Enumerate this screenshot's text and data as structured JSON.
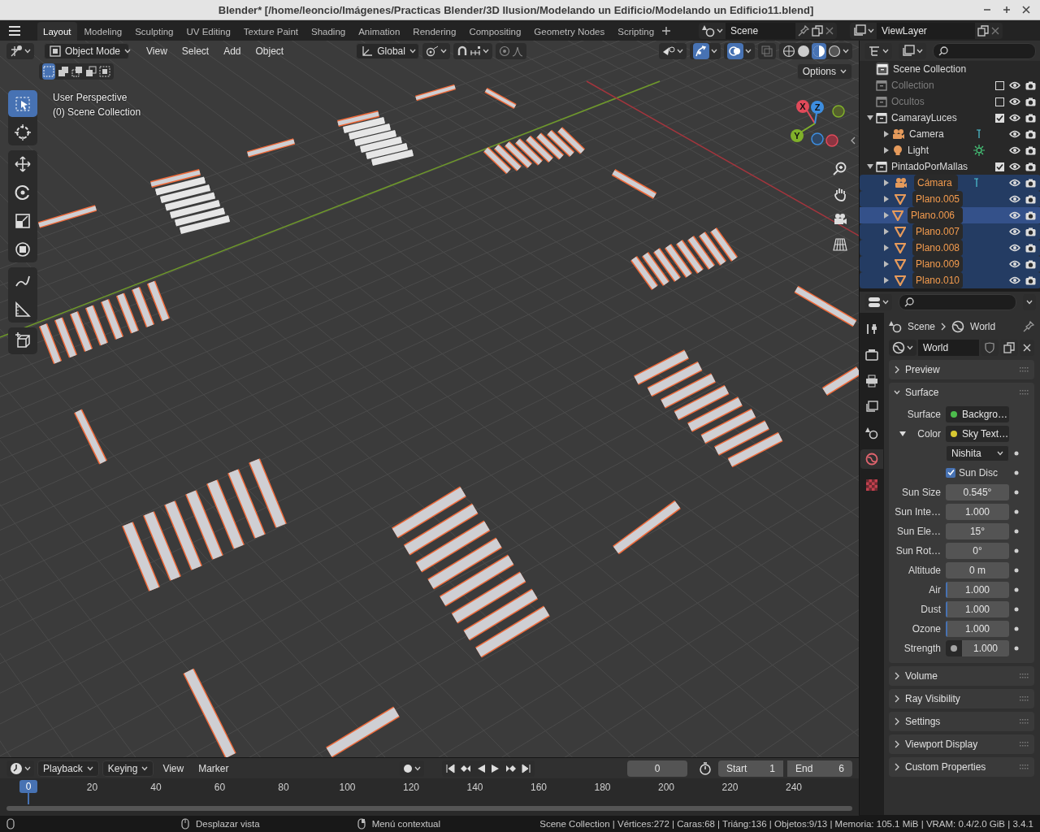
{
  "window": {
    "title": "Blender* [/home/leoncio/Imágenes/Practicas Blender/3D Ilusion/Modelando un Edificio/Modelando un Edificio11.blend]"
  },
  "workspace_tabs": [
    {
      "label": "Layout",
      "selected": true
    },
    {
      "label": "Modeling",
      "selected": false
    },
    {
      "label": "Sculpting",
      "selected": false
    },
    {
      "label": "UV Editing",
      "selected": false
    },
    {
      "label": "Texture Paint",
      "selected": false
    },
    {
      "label": "Shading",
      "selected": false
    },
    {
      "label": "Animation",
      "selected": false
    },
    {
      "label": "Rendering",
      "selected": false
    },
    {
      "label": "Compositing",
      "selected": false
    },
    {
      "label": "Geometry Nodes",
      "selected": false
    },
    {
      "label": "Scripting",
      "selected": false
    }
  ],
  "scene": {
    "name": "Scene"
  },
  "view_layer": {
    "name": "ViewLayer"
  },
  "viewport": {
    "mode": "Object Mode",
    "menus": [
      "View",
      "Select",
      "Add",
      "Object"
    ],
    "orientation": "Global",
    "options_label": "Options",
    "overlay_lines": [
      "User Perspective",
      "(0) Scene Collection"
    ],
    "axes": [
      "X",
      "Z",
      "Y"
    ]
  },
  "outliner": {
    "root": "Scene Collection",
    "items": [
      {
        "name": "Collection",
        "kind": "collection",
        "checked": false
      },
      {
        "name": "Ocultos",
        "kind": "collection",
        "checked": false
      },
      {
        "name": "CamarayLuces",
        "kind": "collection",
        "checked": true,
        "expanded": true,
        "children": [
          {
            "name": "Camera",
            "kind": "camera",
            "expanded": false,
            "selected": false,
            "active": false
          },
          {
            "name": "Light",
            "kind": "light",
            "expanded": false,
            "selected": false,
            "active": false
          }
        ]
      },
      {
        "name": "PintadoPorMallas",
        "kind": "collection",
        "checked": true,
        "expanded": true,
        "children": [
          {
            "name": "Cámara",
            "kind": "camera",
            "expanded": false,
            "selected": true,
            "active": false
          },
          {
            "name": "Plano.005",
            "kind": "mesh",
            "expanded": false,
            "selected": true,
            "active": false
          },
          {
            "name": "Plano.006",
            "kind": "mesh",
            "expanded": false,
            "selected": true,
            "active": true
          },
          {
            "name": "Plano.007",
            "kind": "mesh",
            "expanded": false,
            "selected": true,
            "active": false
          },
          {
            "name": "Plano.008",
            "kind": "mesh",
            "expanded": false,
            "selected": true,
            "active": false
          },
          {
            "name": "Plano.009",
            "kind": "mesh",
            "expanded": false,
            "selected": true,
            "active": false
          },
          {
            "name": "Plano.010",
            "kind": "mesh",
            "expanded": false,
            "selected": true,
            "active": false
          }
        ]
      }
    ]
  },
  "properties": {
    "tabs": [
      {
        "kind": "tool",
        "selected": false
      },
      {
        "kind": "render",
        "selected": false
      },
      {
        "kind": "output",
        "selected": false
      },
      {
        "kind": "view_layer",
        "selected": false
      },
      {
        "kind": "scene",
        "selected": false
      },
      {
        "kind": "world",
        "selected": true
      },
      {
        "kind": "texture",
        "selected": false
      }
    ],
    "breadcrumb": [
      "Scene",
      "World"
    ],
    "datablock": "World",
    "panels": [
      {
        "title": "Preview",
        "expanded": false
      },
      {
        "title": "Surface",
        "expanded": true,
        "rows": [
          {
            "kind": "socket",
            "label": "Surface",
            "value": "Backgro…",
            "color": "#4cbb4c"
          },
          {
            "kind": "socket",
            "label": "Color",
            "value": "Sky Text…",
            "color": "#d8c832",
            "expanded": true
          },
          {
            "kind": "dropdown",
            "value": "Nishita"
          },
          {
            "kind": "checkbox",
            "label": "Sun Disc",
            "checked": true
          },
          {
            "kind": "number",
            "label": "Sun Size",
            "value": "0.545°"
          },
          {
            "kind": "number",
            "label": "Sun Inte…",
            "value": "1.000"
          },
          {
            "kind": "number",
            "label": "Sun Ele…",
            "value": "15°"
          },
          {
            "kind": "number",
            "label": "Sun Rot…",
            "value": "0°"
          },
          {
            "kind": "number",
            "label": "Altitude",
            "value": "0 m"
          },
          {
            "kind": "slider",
            "label": "Air",
            "value": "1.000",
            "level": 0.03
          },
          {
            "kind": "slider",
            "label": "Dust",
            "value": "1.000",
            "level": 0.03
          },
          {
            "kind": "slider",
            "label": "Ozone",
            "value": "1.000",
            "level": 0.03
          },
          {
            "kind": "socket_number",
            "label": "Strength",
            "value": "1.000",
            "color": "#a3a3a3"
          }
        ]
      },
      {
        "title": "Volume",
        "expanded": false
      },
      {
        "title": "Ray Visibility",
        "expanded": false
      },
      {
        "title": "Settings",
        "expanded": false
      },
      {
        "title": "Viewport Display",
        "expanded": false
      },
      {
        "title": "Custom Properties",
        "expanded": false
      }
    ]
  },
  "timeline": {
    "menus": [
      "Playback",
      "Keying",
      "View",
      "Marker"
    ],
    "current_frame": "0",
    "start_label": "Start",
    "start": "1",
    "end_label": "End",
    "end": "6",
    "playhead": "0",
    "ticks": [
      "20",
      "40",
      "60",
      "80",
      "100",
      "120",
      "140",
      "160",
      "180",
      "200",
      "220",
      "240"
    ]
  },
  "status_bar": {
    "hints": [
      "Desplazar vista",
      "Menú contextual"
    ],
    "stats": "Scene Collection | Vértices:272 | Caras:68 | Triáng:136 | Objetos:9/13 | Memoria: 105.1 MiB | VRAM: 0.4/2.0 GiB | 3.4.1"
  }
}
